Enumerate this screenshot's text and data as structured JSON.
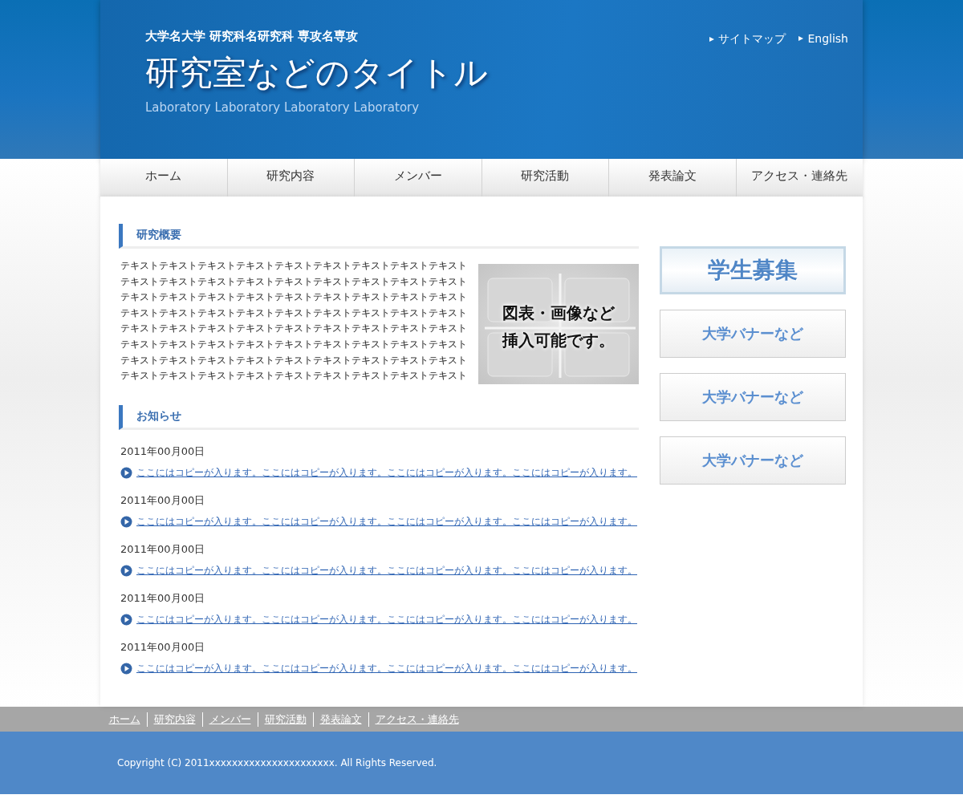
{
  "header": {
    "university": "大学名大学 研究科名研究科 専攻名専攻",
    "title": "研究室などのタイトル",
    "subtitle": "Laboratory Laboratory Laboratory Laboratory",
    "links": [
      "サイトマップ",
      "English"
    ]
  },
  "nav": [
    "ホーム",
    "研究内容",
    "メンバー",
    "研究活動",
    "発表論文",
    "アクセス・連絡先"
  ],
  "overview": {
    "heading": "研究概要",
    "lines": [
      "テキストテキストテキストテキストテキストテキストテキストテキストテキスト",
      "テキストテキストテキストテキストテキストテキストテキストテキストテキスト",
      "テキストテキストテキストテキストテキストテキストテキストテキストテキスト",
      "テキストテキストテキストテキストテキストテキストテキストテキストテキスト",
      "テキストテキストテキストテキストテキストテキストテキストテキストテキスト",
      "テキストテキストテキストテキストテキストテキストテキストテキストテキスト",
      "テキストテキストテキストテキストテキストテキストテキストテキストテキスト",
      "テキストテキストテキストテキストテキストテキストテキストテキストテキスト"
    ],
    "figure": {
      "caption": [
        "図表・画像など",
        "挿入可能です。"
      ]
    }
  },
  "news": {
    "heading": "お知らせ",
    "items": [
      {
        "date": "2011年00月00日",
        "text": "ここにはコピーが入ります。ここにはコピーが入ります。ここにはコピーが入ります。ここにはコピーが入ります。"
      },
      {
        "date": "2011年00月00日",
        "text": "ここにはコピーが入ります。ここにはコピーが入ります。ここにはコピーが入ります。ここにはコピーが入ります。"
      },
      {
        "date": "2011年00月00日",
        "text": "ここにはコピーが入ります。ここにはコピーが入ります。ここにはコピーが入ります。ここにはコピーが入ります。"
      },
      {
        "date": "2011年00月00日",
        "text": "ここにはコピーが入ります。ここにはコピーが入ります。ここにはコピーが入ります。ここにはコピーが入ります。"
      },
      {
        "date": "2011年00月00日",
        "text": "ここにはコピーが入ります。ここにはコピーが入ります。ここにはコピーが入ります。ここにはコピーが入ります。"
      }
    ]
  },
  "banners": [
    {
      "label": "学生募集",
      "kind": "featured"
    },
    {
      "label": "大学バナーなど",
      "kind": "plain"
    },
    {
      "label": "大学バナーなど",
      "kind": "plain"
    },
    {
      "label": "大学バナーなど",
      "kind": "plain"
    }
  ],
  "footer": {
    "links": [
      "ホーム",
      "研究内容",
      "メンバー",
      "研究活動",
      "発表論文",
      "アクセス・連絡先"
    ],
    "copyright": "Copyright (C) 2011xxxxxxxxxxxxxxxxxxxxxx. All Rights Reserved."
  }
}
